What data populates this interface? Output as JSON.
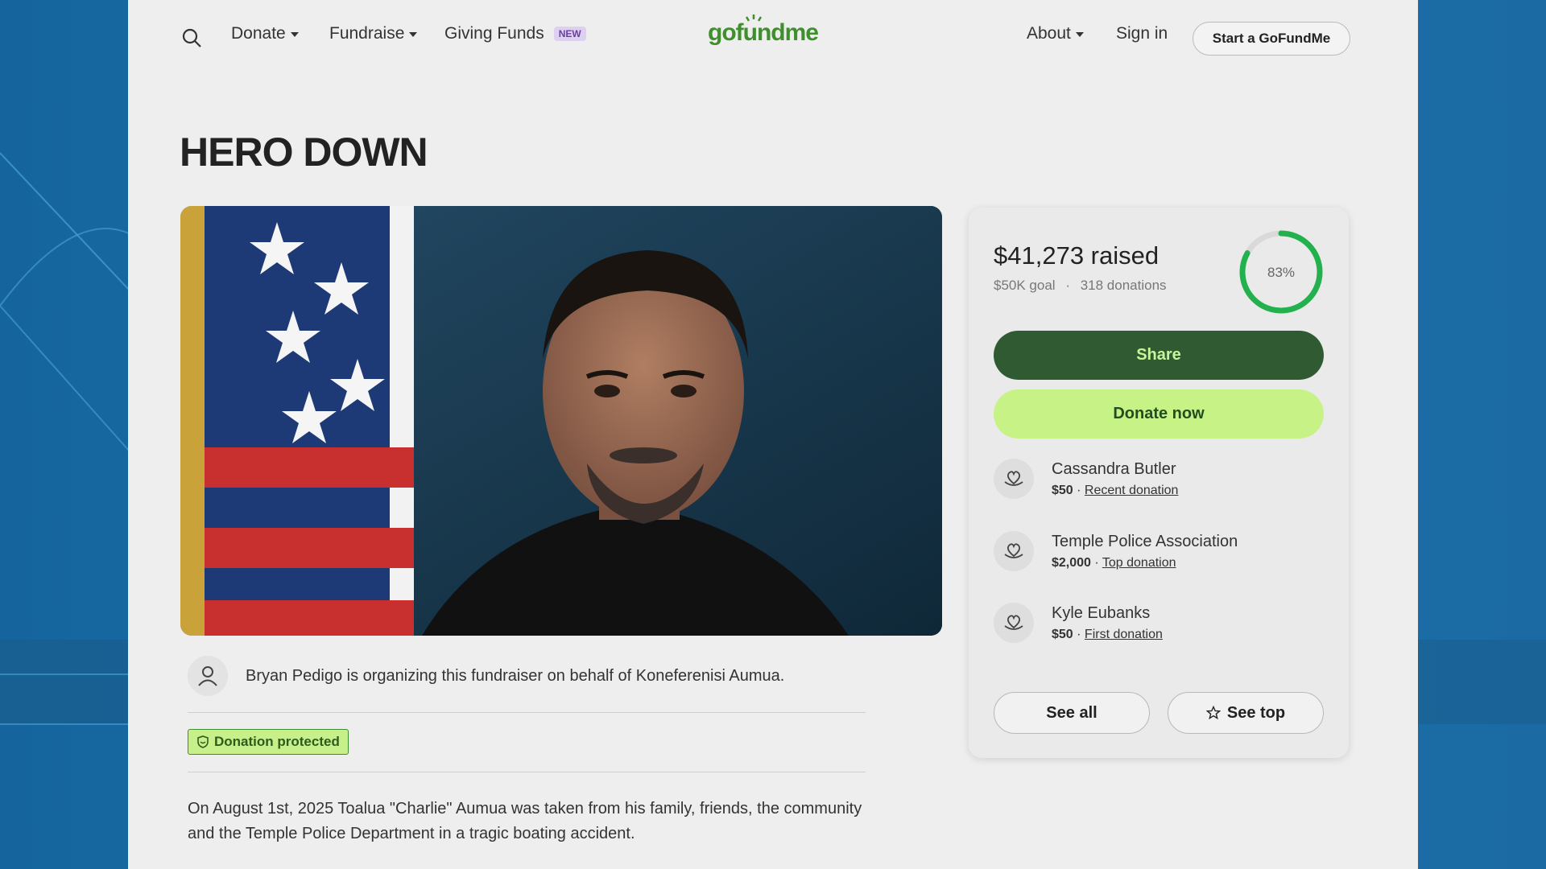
{
  "nav": {
    "donate": "Donate",
    "fundraise": "Fundraise",
    "giving_funds": "Giving Funds",
    "new_badge": "NEW",
    "logo": "gofundme",
    "about": "About",
    "sign_in": "Sign in",
    "start": "Start a GoFundMe"
  },
  "campaign": {
    "title": "HERO DOWN",
    "organizer_text": "Bryan Pedigo is organizing this fundraiser on behalf of Koneferenisi Aumua.",
    "protected_label": "Donation protected",
    "story": "On August 1st, 2025 Toalua \"Charlie\" Aumua was taken from his family, friends, the community and the Temple Police Department in a tragic boating accident."
  },
  "card": {
    "raised": "$41,273 raised",
    "goal": "$50K goal",
    "donations": "318 donations",
    "percent_label": "83%",
    "percent_value": 0.83,
    "share": "Share",
    "donate_now": "Donate now",
    "donors": [
      {
        "name": "Cassandra Butler",
        "amount": "$50",
        "tag": "Recent donation"
      },
      {
        "name": "Temple Police Association",
        "amount": "$2,000",
        "tag": "Top donation"
      },
      {
        "name": "Kyle Eubanks",
        "amount": "$50",
        "tag": "First donation"
      }
    ],
    "see_all": "See all",
    "see_top": "See top"
  },
  "colors": {
    "brand_green": "#3f8f2c",
    "share_bg": "#2f5a32",
    "donate_bg": "#c6f286",
    "ring": "#22b14c"
  }
}
